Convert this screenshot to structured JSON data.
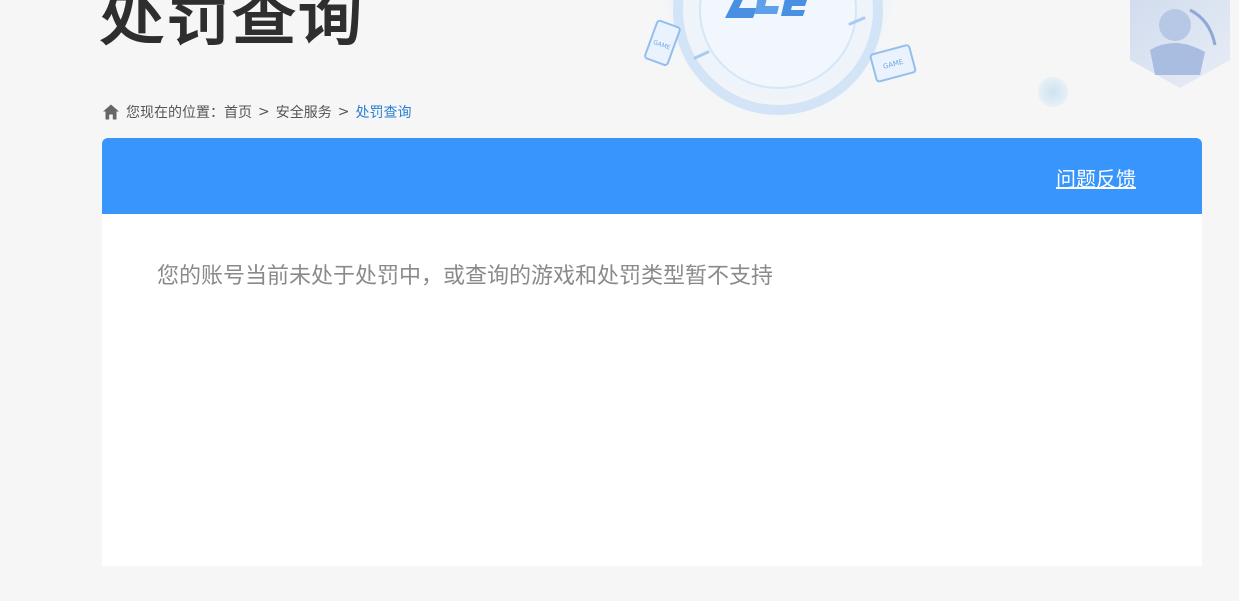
{
  "page": {
    "title": "处罚查询"
  },
  "breadcrumb": {
    "prefix": "您现在的位置：",
    "items": [
      {
        "label": "首页"
      },
      {
        "label": "安全服务"
      }
    ],
    "separator": ">",
    "current": "处罚查询"
  },
  "panel": {
    "feedback_label": "问题反馈",
    "message": "您的账号当前未处于处罚中，或查询的游戏和处罚类型暂不支持"
  },
  "banner": {
    "logo_text": "ACE",
    "badge_text": "GAME"
  },
  "colors": {
    "accent": "#3795fb",
    "link_current": "#2a7fd4",
    "background": "#f6f6f6"
  }
}
